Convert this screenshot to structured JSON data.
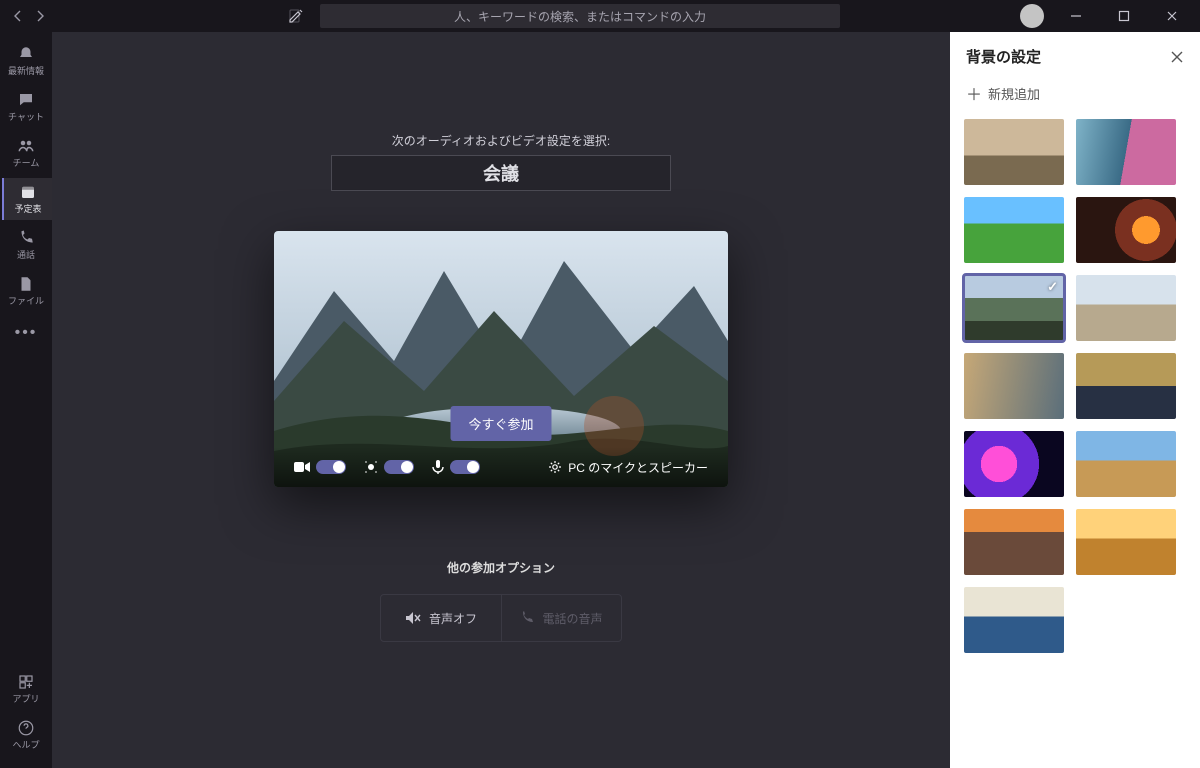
{
  "colors": {
    "accent": "#6264a7"
  },
  "titlebar": {
    "search_placeholder": "人、キーワードの検索、またはコマンドの入力"
  },
  "rail": {
    "items": [
      {
        "id": "activity",
        "label": "最新情報"
      },
      {
        "id": "chat",
        "label": "チャット"
      },
      {
        "id": "teams",
        "label": "チーム"
      },
      {
        "id": "calendar",
        "label": "予定表",
        "active": true
      },
      {
        "id": "calls",
        "label": "通話"
      },
      {
        "id": "files",
        "label": "ファイル"
      }
    ],
    "apps_label": "アプリ",
    "help_label": "ヘルプ"
  },
  "prejoin": {
    "select_label": "次のオーディオおよびビデオ設定を選択:",
    "meeting_title": "会議",
    "join_button": "今すぐ参加",
    "device_label": "PC のマイクとスピーカー",
    "camera_on": true,
    "blur_on": true,
    "mic_on": true,
    "other_options_header": "他の参加オプション",
    "opt_audio_off": "音声オフ",
    "opt_phone_audio": "電話の音声"
  },
  "background_panel": {
    "title": "背景の設定",
    "add_new": "新規追加",
    "selected_index": 4,
    "thumbnails": [
      {
        "id": "classroom",
        "art": "art-classroom"
      },
      {
        "id": "scifi-room",
        "art": "art-scifi"
      },
      {
        "id": "block-world",
        "art": "art-blocks"
      },
      {
        "id": "lava-cave",
        "art": "art-cave"
      },
      {
        "id": "mountain-lake",
        "art": "art-mountain"
      },
      {
        "id": "stone-arch",
        "art": "art-arch"
      },
      {
        "id": "old-street",
        "art": "art-street"
      },
      {
        "id": "alien-planet",
        "art": "art-planet"
      },
      {
        "id": "nebula",
        "art": "art-nebula"
      },
      {
        "id": "coastal-city",
        "art": "art-coast"
      },
      {
        "id": "sunset-village",
        "art": "art-village"
      },
      {
        "id": "desert-sunset",
        "art": "art-sunset"
      },
      {
        "id": "great-wave",
        "art": "art-wave"
      }
    ]
  }
}
